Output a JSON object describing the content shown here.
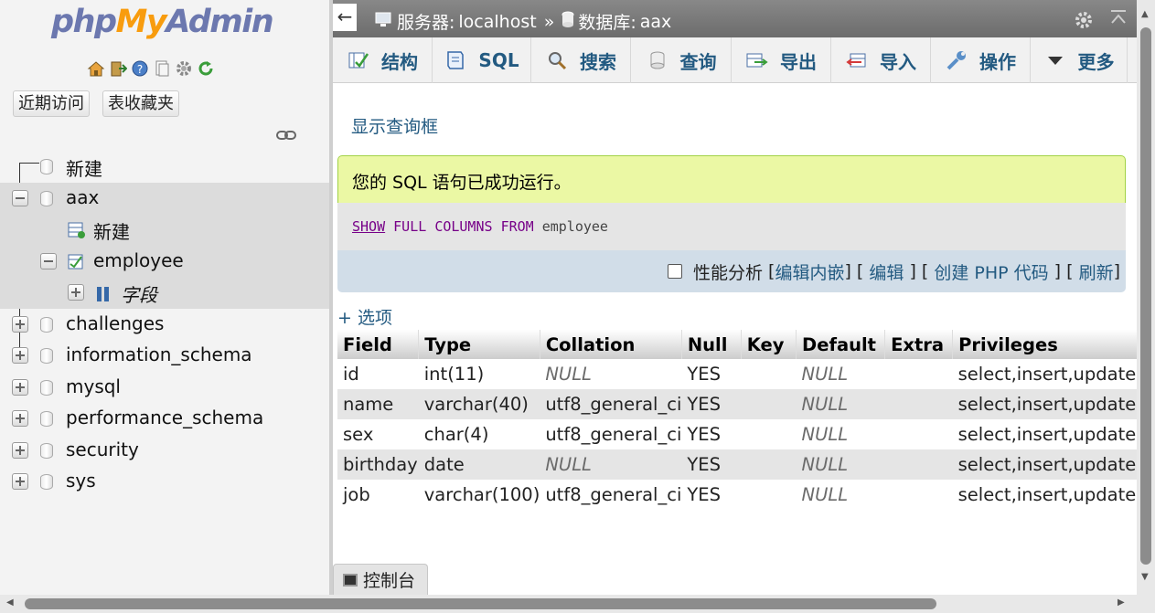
{
  "logo": {
    "part1": "php",
    "part2": "My",
    "part3": "Admin"
  },
  "nav": {
    "icons": [
      "home-icon",
      "logout-icon",
      "help-icon",
      "docs-icon",
      "settings-icon",
      "reload-icon"
    ],
    "tab_recent": "近期访问",
    "tab_favorites": "表收藏夹",
    "tree": {
      "new": "新建",
      "aax": "aax",
      "aax_new": "新建",
      "employee": "employee",
      "columns": "字段",
      "dbs": [
        "challenges",
        "information_schema",
        "mysql",
        "performance_schema",
        "security",
        "sys"
      ]
    }
  },
  "topbar": {
    "back": "←",
    "server_label": "服务器:",
    "server": "localhost",
    "sep": "»",
    "db_label": "数据库:",
    "db": "aax"
  },
  "tabs": [
    {
      "label": "结构",
      "icon": "structure-icon"
    },
    {
      "label": "SQL",
      "icon": "sql-icon"
    },
    {
      "label": "搜索",
      "icon": "search-icon"
    },
    {
      "label": "查询",
      "icon": "query-icon"
    },
    {
      "label": "导出",
      "icon": "export-icon"
    },
    {
      "label": "导入",
      "icon": "import-icon"
    },
    {
      "label": "操作",
      "icon": "operations-icon"
    },
    {
      "label": "更多",
      "icon": "more-icon"
    }
  ],
  "main": {
    "show_query": "显示查询框",
    "success": "您的 SQL 语句已成功运行。",
    "sql": {
      "kw1": "SHOW",
      "kw2": "FULL",
      "kw3": "COLUMNS",
      "kw4": "FROM",
      "table": "employee"
    },
    "actions": {
      "profiling": "性能分析",
      "edit_inline": "编辑内嵌",
      "edit": "编辑",
      "create_php": "创建 PHP 代码",
      "refresh": "刷新",
      "lb": "[",
      "rb": "]"
    },
    "options": "+ 选项",
    "columns": [
      "Field",
      "Type",
      "Collation",
      "Null",
      "Key",
      "Default",
      "Extra",
      "Privileges"
    ],
    "rows": [
      [
        "id",
        "int(11)",
        "NULL",
        "YES",
        "",
        "NULL",
        "",
        "select,insert,update,"
      ],
      [
        "name",
        "varchar(40)",
        "utf8_general_ci",
        "YES",
        "",
        "NULL",
        "",
        "select,insert,update,"
      ],
      [
        "sex",
        "char(4)",
        "utf8_general_ci",
        "YES",
        "",
        "NULL",
        "",
        "select,insert,update,"
      ],
      [
        "birthday",
        "date",
        "NULL",
        "YES",
        "",
        "NULL",
        "",
        "select,insert,update,"
      ],
      [
        "job",
        "varchar(100)",
        "utf8_general_ci",
        "YES",
        "",
        "NULL",
        "",
        "select,insert,update,"
      ]
    ]
  },
  "console": "控制台",
  "colors": {
    "link": "#235a81",
    "success_bg": "#ebf8a4",
    "topbar": "#7a7a7a",
    "keyword": "#770088"
  }
}
